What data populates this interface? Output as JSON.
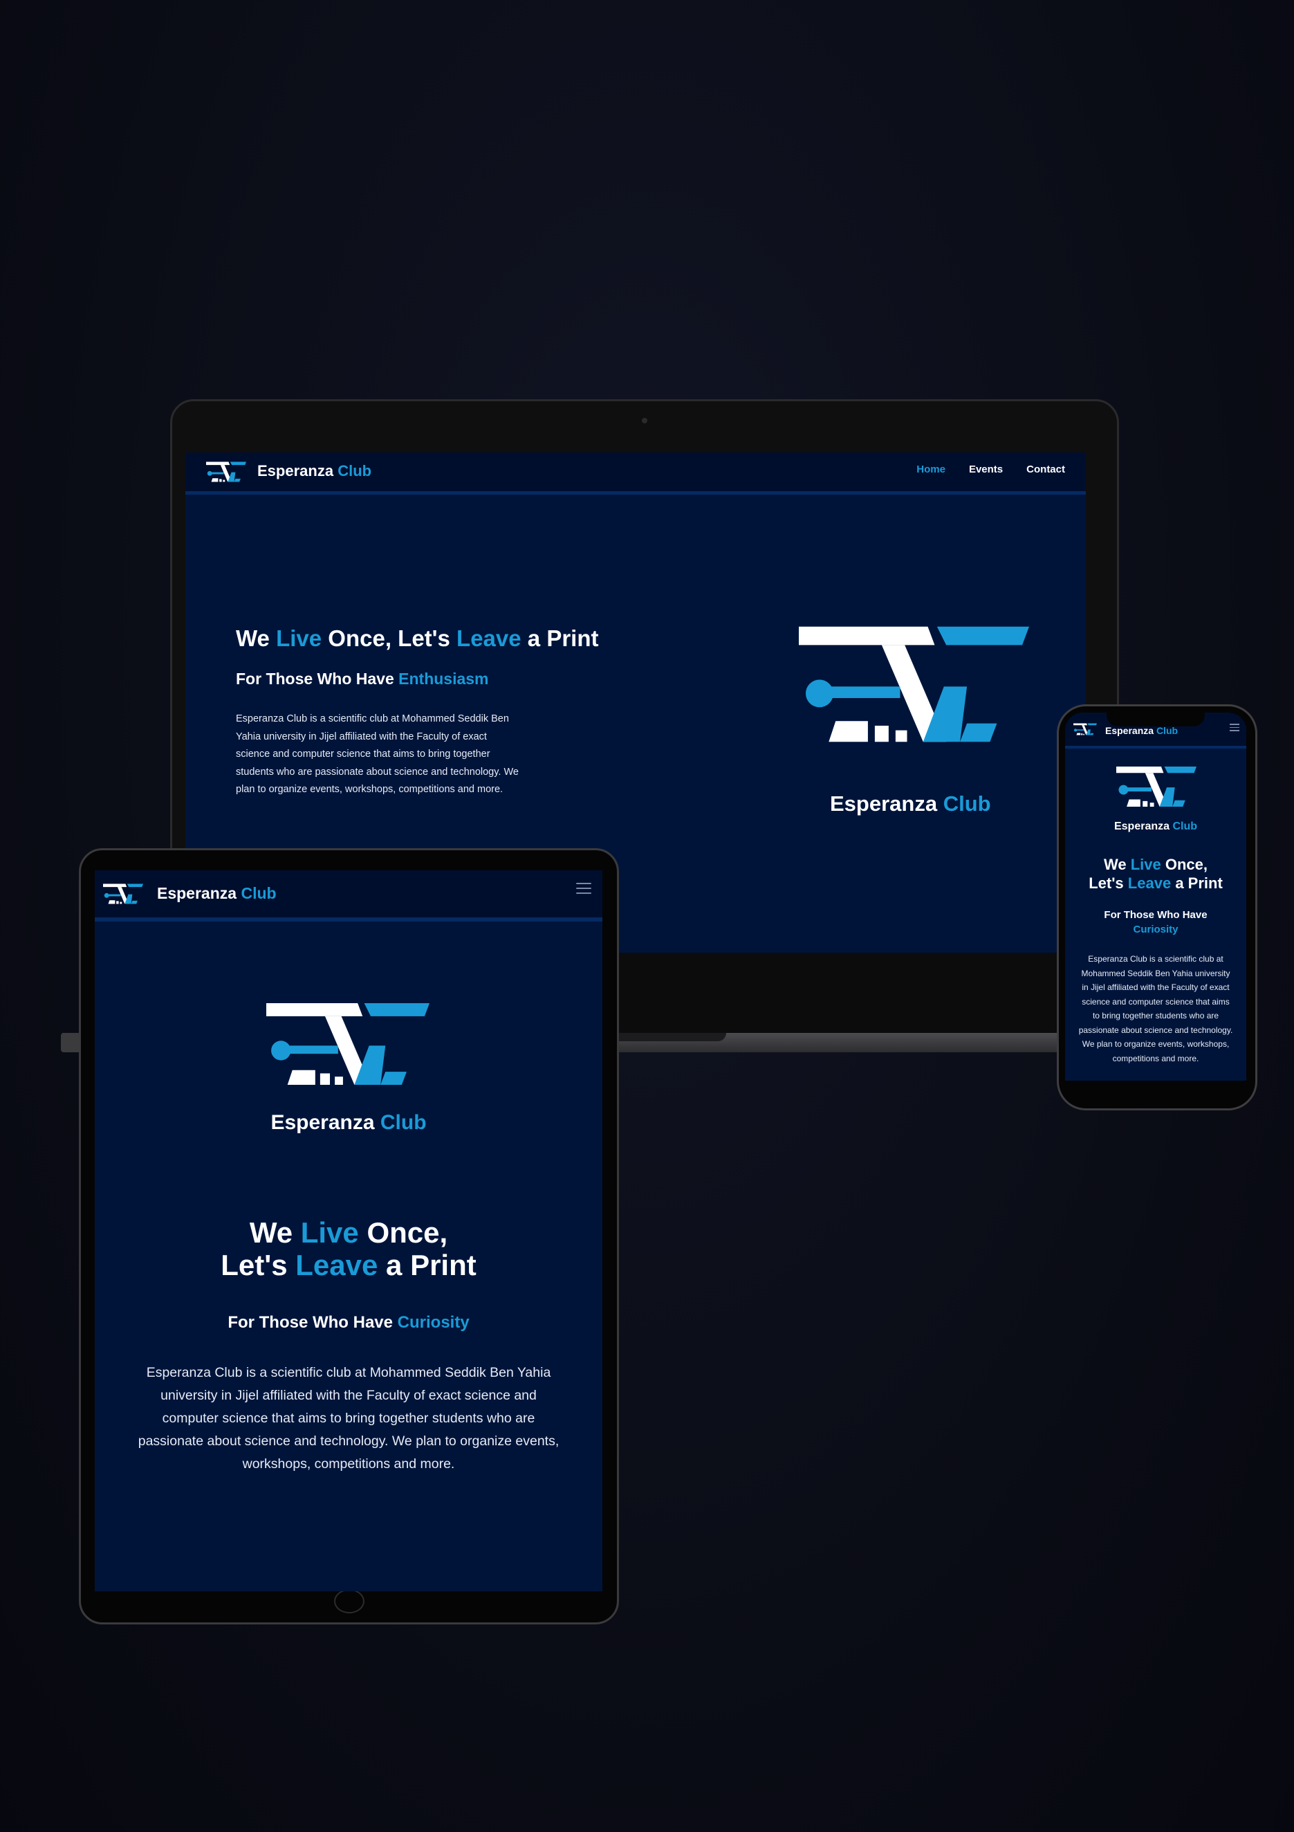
{
  "brand": {
    "name_part1": "Esperanza",
    "name_part2": "Club"
  },
  "nav": {
    "items": [
      "Home",
      "Events",
      "Contact"
    ],
    "active": "Home"
  },
  "hero": {
    "headline": {
      "w1": "We",
      "w2": "Live",
      "w3": "Once, Let's",
      "w3a": "Once,",
      "w3b": "Let's",
      "w4": "Leave",
      "w5": "a Print"
    },
    "subtitle_prefix": "For Those Who Have",
    "subtitle_word_desktop": "Enthusiasm",
    "subtitle_word_tablet": "Curiosity",
    "subtitle_word_phone": "Curiosity",
    "description": "Esperanza Club is a scientific club at Mohammed Seddik Ben Yahia university in Jijel affiliated with the Faculty of exact science and computer science that aims to bring together students who are passionate about science and technology. We plan to organize events, workshops, competitions and more."
  },
  "colors": {
    "accent": "#1a9bd7",
    "screen_bg": "#00143a",
    "nav_bg": "#000e2e",
    "page_bg": "#0b0d17"
  },
  "icons": {
    "logo": "esperanza-logo-icon",
    "menu": "hamburger-menu-icon"
  }
}
